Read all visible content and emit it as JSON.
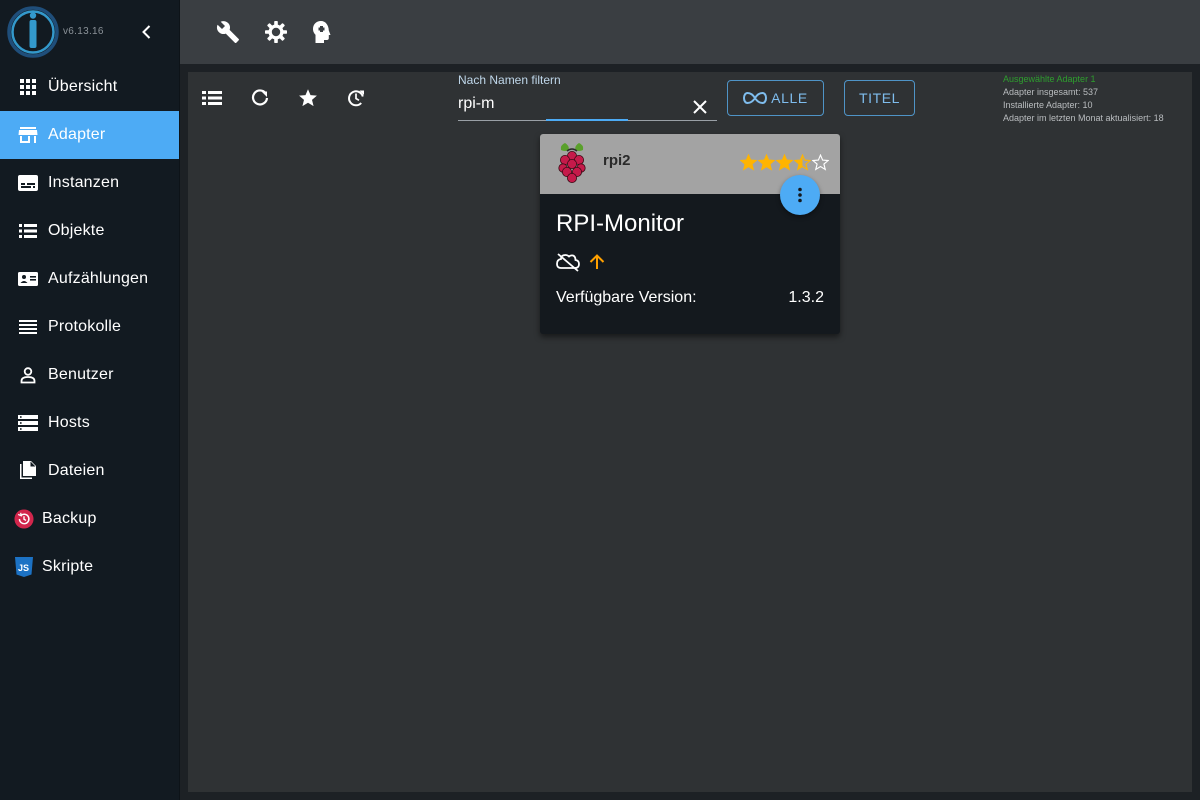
{
  "sidebar": {
    "version": "v6.13.16",
    "items": [
      {
        "label": "Übersicht",
        "icon": "apps-grid-icon",
        "active": false
      },
      {
        "label": "Adapter",
        "icon": "store-icon",
        "active": true
      },
      {
        "label": "Instanzen",
        "icon": "subtitles-icon",
        "active": false
      },
      {
        "label": "Objekte",
        "icon": "list-icon",
        "active": false
      },
      {
        "label": "Aufzählungen",
        "icon": "recent-actors-icon",
        "active": false
      },
      {
        "label": "Protokolle",
        "icon": "lines-icon",
        "active": false
      },
      {
        "label": "Benutzer",
        "icon": "person-icon",
        "active": false
      },
      {
        "label": "Hosts",
        "icon": "storage-icon",
        "active": false
      },
      {
        "label": "Dateien",
        "icon": "file-copy-icon",
        "active": false
      },
      {
        "label": "Backup",
        "icon": "backup-icon",
        "active": false
      },
      {
        "label": "Skripte",
        "icon": "javascript-icon",
        "active": false
      }
    ]
  },
  "topbar": {
    "icons": [
      "wrench-icon",
      "settings-gear-icon",
      "expert-head-icon"
    ]
  },
  "toolbar": {
    "icons": [
      "list-view-icon",
      "refresh-icon",
      "star-icon",
      "update-icon"
    ]
  },
  "filter": {
    "label": "Nach Namen filtern",
    "value": "rpi-m"
  },
  "buttons": {
    "all": "ALLE",
    "title": "TITEL"
  },
  "stats": {
    "selected": "Ausgewählte Adapter 1",
    "total": "Adapter insgesamt: 537",
    "installed": "Installierte Adapter: 10",
    "updated": "Adapter im letzten Monat aktualisiert: 18"
  },
  "card": {
    "name": "rpi2",
    "title": "RPI-Monitor",
    "rating": 3.5,
    "rating_max": 5,
    "version_label": "Verfügbare Version:",
    "version_value": "1.3.2",
    "status_icons": [
      "cloud-off-icon",
      "arrow-up-icon"
    ]
  },
  "colors": {
    "accent": "#4dabf5",
    "star": "#ffb400",
    "warning": "#ffa000",
    "selected_text": "#2e9e2e"
  }
}
